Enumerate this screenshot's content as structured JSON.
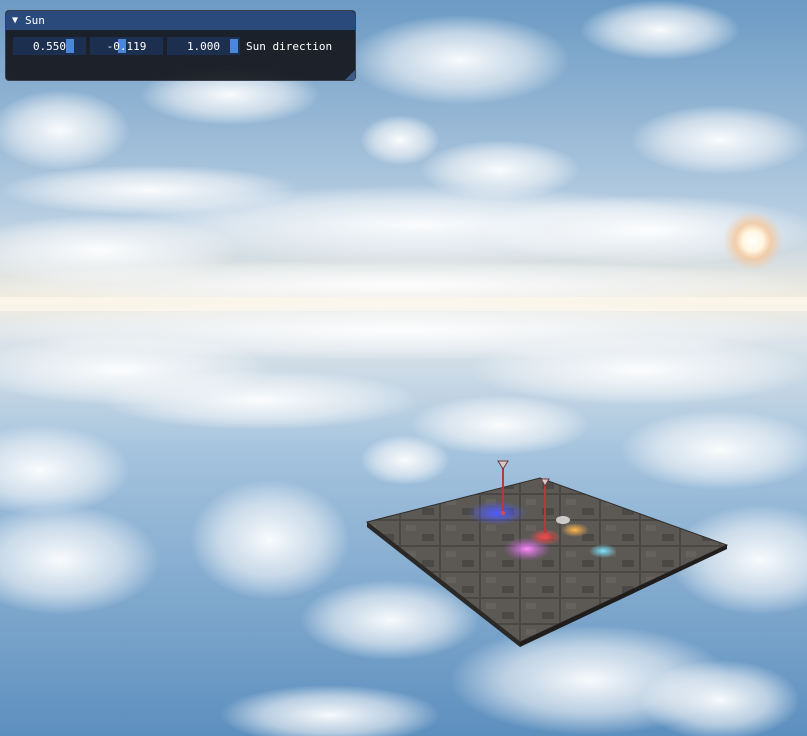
{
  "window": {
    "title": "Sun",
    "collapse_icon": "triangle-down-icon"
  },
  "sun_direction": {
    "label": "Sun direction",
    "x": "0.550",
    "y": "-0.119",
    "z": "1.000"
  },
  "colors": {
    "titlebar": "#294a7a",
    "field_bg": "#1d2f4e",
    "slider_grab": "#4a86d9",
    "sky": "#7fa7cc"
  }
}
